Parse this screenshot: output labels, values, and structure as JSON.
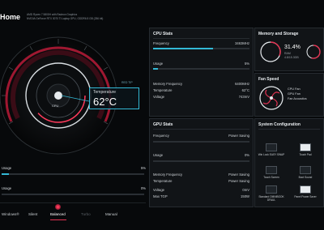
{
  "header": {
    "title": "Home",
    "cpu_name": "AMD Ryzen 7 5800H with Radeon Graphics",
    "gpu_name": "NVIDIA GeForce RTX 3070 Ti Laptop GPU, GDDR6 8 GB (256 bit)"
  },
  "dial": {
    "cpu_label": "CPU",
    "temperature_label": "Temperature",
    "temperature_value": "62°C",
    "temp_tag": "RED TIP"
  },
  "left_stats": [
    {
      "label": "Usage",
      "value": "5%",
      "fill": 0.05
    },
    {
      "label": "Usage",
      "value": "0%",
      "fill": 0.0
    }
  ],
  "modes": {
    "windows": "Windows®",
    "silent": "Silent",
    "balanced": "Balanced",
    "turbo": "Turbo",
    "manual": "Manual",
    "selected": "Balanced"
  },
  "cpu_stats": {
    "title": "CPU Stats",
    "frequency_label": "Frequency",
    "frequency_value": "3463MHz",
    "frequency_fill": 0.62,
    "usage_label": "Usage",
    "usage_value": "5%",
    "usage_fill": 0.05,
    "mem_freq_label": "Memory Frequency",
    "mem_freq_value": "6400MHz",
    "temp_label": "Temperature",
    "temp_value": "62°C",
    "voltage_label": "Voltage",
    "voltage_value": "743mV"
  },
  "memory": {
    "title": "Memory and Storage",
    "ram_percent": "31.4%",
    "ram_label": "RAM",
    "ram_detail": "4.8/15.3GB",
    "ram_fill": 0.314,
    "storage_fill": 0.55
  },
  "fan": {
    "title": "Fan Speed",
    "cpu_fan": "CPU Fan",
    "gpu_fan": "GPU Fan",
    "fan_acoustics": "Fan Acoustics"
  },
  "gpu_stats": {
    "title": "GPU Stats",
    "frequency_label": "Frequency",
    "frequency_value": "Power Saving",
    "usage_label": "Usage",
    "usage_value": "0%",
    "mem_freq_label": "Memory Frequency",
    "mem_freq_value": "Power Saving",
    "temp_label": "Temperature",
    "temp_value": "Power Saving",
    "voltage_label": "Voltage",
    "voltage_value": "0mV",
    "tgp_label": "Max TGP",
    "tgp_value": "150W"
  },
  "system": {
    "title": "System Configuration",
    "items": [
      {
        "label": "Win Lock\nEASY SWAP",
        "on": false
      },
      {
        "label": "Touch Pad",
        "on": true
      },
      {
        "label": "Touch Screen",
        "on": false
      },
      {
        "label": "Boot Sound",
        "on": false
      },
      {
        "label": "Standard\nOMNIBOOK DFAUL",
        "on": false
      },
      {
        "label": "Panel Power Saver",
        "on": true
      }
    ]
  }
}
